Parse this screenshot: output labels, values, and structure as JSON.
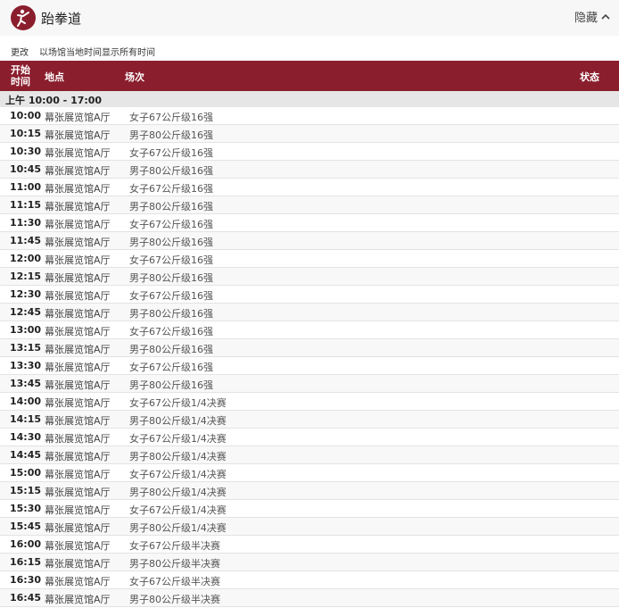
{
  "header": {
    "logo_icon": "taekwondo-pictogram-icon",
    "logo_color": "#8a1e2d",
    "sport_name": "跆拳道",
    "toggle_label": "隐藏",
    "toggle_icon": "chevron-up-icon"
  },
  "timezone": {
    "change_label": "更改",
    "description": "以场馆当地时间显示所有时间"
  },
  "table": {
    "header_color": "#8a1e2d",
    "columns": {
      "time": "开始时间",
      "venue": "地点",
      "event": "场次",
      "status": "状态"
    },
    "session_label": "上午  10:00 - 17:00",
    "rows": [
      {
        "time": "10:00",
        "venue": "幕张展览馆A厅",
        "event": "女子67公斤级16强"
      },
      {
        "time": "10:15",
        "venue": "幕张展览馆A厅",
        "event": "男子80公斤级16强"
      },
      {
        "time": "10:30",
        "venue": "幕张展览馆A厅",
        "event": "女子67公斤级16强"
      },
      {
        "time": "10:45",
        "venue": "幕张展览馆A厅",
        "event": "男子80公斤级16强"
      },
      {
        "time": "11:00",
        "venue": "幕张展览馆A厅",
        "event": "女子67公斤级16强"
      },
      {
        "time": "11:15",
        "venue": "幕张展览馆A厅",
        "event": "男子80公斤级16强"
      },
      {
        "time": "11:30",
        "venue": "幕张展览馆A厅",
        "event": "女子67公斤级16强"
      },
      {
        "time": "11:45",
        "venue": "幕张展览馆A厅",
        "event": "男子80公斤级16强"
      },
      {
        "time": "12:00",
        "venue": "幕张展览馆A厅",
        "event": "女子67公斤级16强"
      },
      {
        "time": "12:15",
        "venue": "幕张展览馆A厅",
        "event": "男子80公斤级16强"
      },
      {
        "time": "12:30",
        "venue": "幕张展览馆A厅",
        "event": "女子67公斤级16强"
      },
      {
        "time": "12:45",
        "venue": "幕张展览馆A厅",
        "event": "男子80公斤级16强"
      },
      {
        "time": "13:00",
        "venue": "幕张展览馆A厅",
        "event": "女子67公斤级16强"
      },
      {
        "time": "13:15",
        "venue": "幕张展览馆A厅",
        "event": "男子80公斤级16强"
      },
      {
        "time": "13:30",
        "venue": "幕张展览馆A厅",
        "event": "女子67公斤级16强"
      },
      {
        "time": "13:45",
        "venue": "幕张展览馆A厅",
        "event": "男子80公斤级16强"
      },
      {
        "time": "14:00",
        "venue": "幕张展览馆A厅",
        "event": "女子67公斤级1/4决赛"
      },
      {
        "time": "14:15",
        "venue": "幕张展览馆A厅",
        "event": "男子80公斤级1/4决赛"
      },
      {
        "time": "14:30",
        "venue": "幕张展览馆A厅",
        "event": "女子67公斤级1/4决赛"
      },
      {
        "time": "14:45",
        "venue": "幕张展览馆A厅",
        "event": "男子80公斤级1/4决赛"
      },
      {
        "time": "15:00",
        "venue": "幕张展览馆A厅",
        "event": "女子67公斤级1/4决赛"
      },
      {
        "time": "15:15",
        "venue": "幕张展览馆A厅",
        "event": "男子80公斤级1/4决赛"
      },
      {
        "time": "15:30",
        "venue": "幕张展览馆A厅",
        "event": "女子67公斤级1/4决赛"
      },
      {
        "time": "15:45",
        "venue": "幕张展览馆A厅",
        "event": "男子80公斤级1/4决赛"
      },
      {
        "time": "16:00",
        "venue": "幕张展览馆A厅",
        "event": "女子67公斤级半决赛"
      },
      {
        "time": "16:15",
        "venue": "幕张展览馆A厅",
        "event": "男子80公斤级半决赛"
      },
      {
        "time": "16:30",
        "venue": "幕张展览馆A厅",
        "event": "女子67公斤级半决赛"
      },
      {
        "time": "16:45",
        "venue": "幕张展览馆A厅",
        "event": "男子80公斤级半决赛"
      }
    ]
  }
}
